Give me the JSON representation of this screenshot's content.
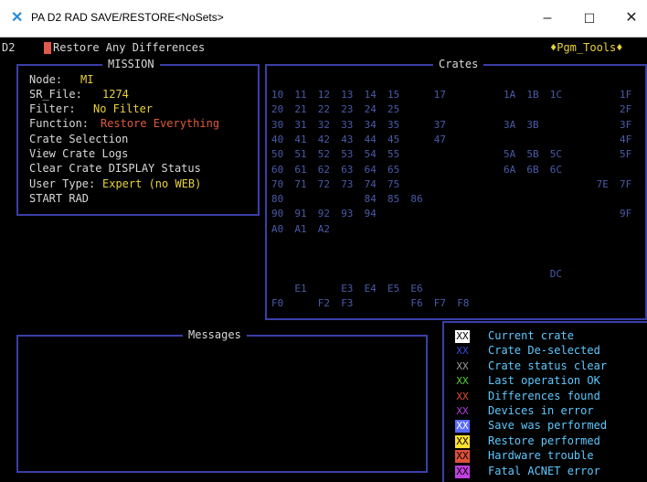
{
  "window": {
    "title": "PA D2  RAD SAVE/RESTORE<NoSets>",
    "minimize": "–",
    "maximize": "☐",
    "close": "✕"
  },
  "header": {
    "node_code": "D2",
    "program_title": "Restore Any Differences",
    "pgm_tools": "♦Pgm_Tools♦"
  },
  "mission": {
    "legend": "MISSION",
    "node_label": "Node:",
    "node_value": "MI",
    "file_label": "SR_File:",
    "file_value": "1274",
    "filter_label": "Filter:",
    "filter_value": "No Filter",
    "function_label": "Function:",
    "function_value": "Restore Everything",
    "crate_selection": "Crate Selection",
    "view_logs": "View Crate Logs",
    "clear_status": "Clear Crate DISPLAY Status",
    "user_type_label": "User Type:",
    "user_type_value": "Expert (no WEB)",
    "start": "START RAD"
  },
  "crates": {
    "legend": "Crates",
    "items": [
      {
        "label": "10",
        "col": 0,
        "row": 0
      },
      {
        "label": "11",
        "col": 1,
        "row": 0
      },
      {
        "label": "12",
        "col": 2,
        "row": 0
      },
      {
        "label": "13",
        "col": 3,
        "row": 0
      },
      {
        "label": "14",
        "col": 4,
        "row": 0
      },
      {
        "label": "15",
        "col": 5,
        "row": 0
      },
      {
        "label": "17",
        "col": 7,
        "row": 0
      },
      {
        "label": "1A",
        "col": 10,
        "row": 0
      },
      {
        "label": "1B",
        "col": 11,
        "row": 0
      },
      {
        "label": "1C",
        "col": 12,
        "row": 0
      },
      {
        "label": "1F",
        "col": 15,
        "row": 0
      },
      {
        "label": "20",
        "col": 0,
        "row": 1
      },
      {
        "label": "21",
        "col": 1,
        "row": 1
      },
      {
        "label": "22",
        "col": 2,
        "row": 1
      },
      {
        "label": "23",
        "col": 3,
        "row": 1
      },
      {
        "label": "24",
        "col": 4,
        "row": 1
      },
      {
        "label": "25",
        "col": 5,
        "row": 1
      },
      {
        "label": "2F",
        "col": 15,
        "row": 1
      },
      {
        "label": "30",
        "col": 0,
        "row": 2
      },
      {
        "label": "31",
        "col": 1,
        "row": 2
      },
      {
        "label": "32",
        "col": 2,
        "row": 2
      },
      {
        "label": "33",
        "col": 3,
        "row": 2
      },
      {
        "label": "34",
        "col": 4,
        "row": 2
      },
      {
        "label": "35",
        "col": 5,
        "row": 2
      },
      {
        "label": "37",
        "col": 7,
        "row": 2
      },
      {
        "label": "3A",
        "col": 10,
        "row": 2
      },
      {
        "label": "3B",
        "col": 11,
        "row": 2
      },
      {
        "label": "3F",
        "col": 15,
        "row": 2
      },
      {
        "label": "40",
        "col": 0,
        "row": 3
      },
      {
        "label": "41",
        "col": 1,
        "row": 3
      },
      {
        "label": "42",
        "col": 2,
        "row": 3
      },
      {
        "label": "43",
        "col": 3,
        "row": 3
      },
      {
        "label": "44",
        "col": 4,
        "row": 3
      },
      {
        "label": "45",
        "col": 5,
        "row": 3
      },
      {
        "label": "47",
        "col": 7,
        "row": 3
      },
      {
        "label": "4F",
        "col": 15,
        "row": 3
      },
      {
        "label": "50",
        "col": 0,
        "row": 4
      },
      {
        "label": "51",
        "col": 1,
        "row": 4
      },
      {
        "label": "52",
        "col": 2,
        "row": 4
      },
      {
        "label": "53",
        "col": 3,
        "row": 4
      },
      {
        "label": "54",
        "col": 4,
        "row": 4
      },
      {
        "label": "55",
        "col": 5,
        "row": 4
      },
      {
        "label": "5A",
        "col": 10,
        "row": 4
      },
      {
        "label": "5B",
        "col": 11,
        "row": 4
      },
      {
        "label": "5C",
        "col": 12,
        "row": 4
      },
      {
        "label": "5F",
        "col": 15,
        "row": 4
      },
      {
        "label": "60",
        "col": 0,
        "row": 5
      },
      {
        "label": "61",
        "col": 1,
        "row": 5
      },
      {
        "label": "62",
        "col": 2,
        "row": 5
      },
      {
        "label": "63",
        "col": 3,
        "row": 5
      },
      {
        "label": "64",
        "col": 4,
        "row": 5
      },
      {
        "label": "65",
        "col": 5,
        "row": 5
      },
      {
        "label": "6A",
        "col": 10,
        "row": 5
      },
      {
        "label": "6B",
        "col": 11,
        "row": 5
      },
      {
        "label": "6C",
        "col": 12,
        "row": 5
      },
      {
        "label": "70",
        "col": 0,
        "row": 6
      },
      {
        "label": "71",
        "col": 1,
        "row": 6
      },
      {
        "label": "72",
        "col": 2,
        "row": 6
      },
      {
        "label": "73",
        "col": 3,
        "row": 6
      },
      {
        "label": "74",
        "col": 4,
        "row": 6
      },
      {
        "label": "75",
        "col": 5,
        "row": 6
      },
      {
        "label": "7E",
        "col": 14,
        "row": 6
      },
      {
        "label": "7F",
        "col": 15,
        "row": 6
      },
      {
        "label": "80",
        "col": 0,
        "row": 7
      },
      {
        "label": "84",
        "col": 4,
        "row": 7
      },
      {
        "label": "85",
        "col": 5,
        "row": 7
      },
      {
        "label": "86",
        "col": 6,
        "row": 7
      },
      {
        "label": "90",
        "col": 0,
        "row": 8
      },
      {
        "label": "91",
        "col": 1,
        "row": 8
      },
      {
        "label": "92",
        "col": 2,
        "row": 8
      },
      {
        "label": "93",
        "col": 3,
        "row": 8
      },
      {
        "label": "94",
        "col": 4,
        "row": 8
      },
      {
        "label": "9F",
        "col": 15,
        "row": 8
      },
      {
        "label": "A0",
        "col": 0,
        "row": 9
      },
      {
        "label": "A1",
        "col": 1,
        "row": 9
      },
      {
        "label": "A2",
        "col": 2,
        "row": 9
      },
      {
        "label": "DC",
        "col": 12,
        "row": 12
      },
      {
        "label": "E1",
        "col": 1,
        "row": 13
      },
      {
        "label": "E3",
        "col": 3,
        "row": 13
      },
      {
        "label": "E4",
        "col": 4,
        "row": 13
      },
      {
        "label": "E5",
        "col": 5,
        "row": 13
      },
      {
        "label": "E6",
        "col": 6,
        "row": 13
      },
      {
        "label": "F0",
        "col": 0,
        "row": 14
      },
      {
        "label": "F2",
        "col": 2,
        "row": 14
      },
      {
        "label": "F3",
        "col": 3,
        "row": 14
      },
      {
        "label": "F6",
        "col": 6,
        "row": 14
      },
      {
        "label": "F7",
        "col": 7,
        "row": 14
      },
      {
        "label": "F8",
        "col": 8,
        "row": 14
      }
    ]
  },
  "messages": {
    "legend": "Messages"
  },
  "legend_items": [
    {
      "mark": "XX",
      "label": "Current crate",
      "fg": "#000000",
      "bg": "#ffffff"
    },
    {
      "mark": "XX",
      "label": "Crate De-selected",
      "fg": "#3a4bd8",
      "bg": ""
    },
    {
      "mark": "XX",
      "label": "Crate status clear",
      "fg": "#9a9a9a",
      "bg": ""
    },
    {
      "mark": "XX",
      "label": "Last operation OK",
      "fg": "#5ad23a",
      "bg": ""
    },
    {
      "mark": "XX",
      "label": "Differences found",
      "fg": "#e0503a",
      "bg": ""
    },
    {
      "mark": "XX",
      "label": "Devices in error",
      "fg": "#b040e0",
      "bg": ""
    },
    {
      "mark": "XX",
      "label": "Save was performed",
      "fg": "#ffffff",
      "bg": "#5a6aff"
    },
    {
      "mark": "XX",
      "label": "Restore performed",
      "fg": "#000000",
      "bg": "#ffe030"
    },
    {
      "mark": "XX",
      "label": "Hardware trouble",
      "fg": "#000000",
      "bg": "#e0503a"
    },
    {
      "mark": "XX",
      "label": "Fatal ACNET error",
      "fg": "#000000",
      "bg": "#c040e0"
    }
  ]
}
